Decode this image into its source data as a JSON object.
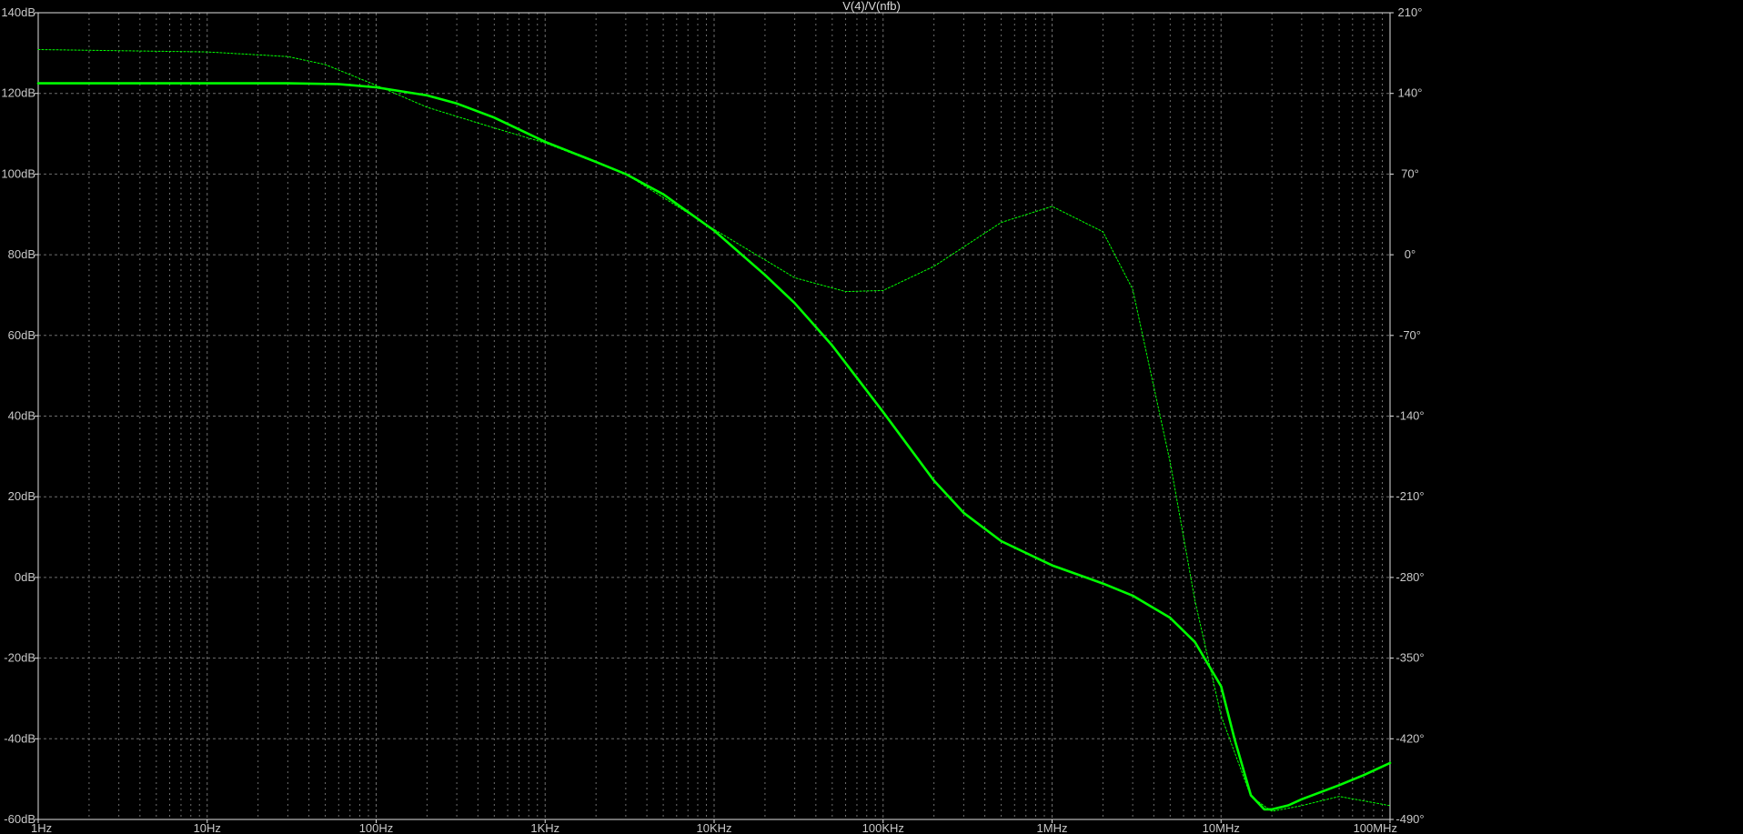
{
  "window": {
    "title": "V(4)/V(nfb)"
  },
  "colors": {
    "background": "#000000",
    "frame": "#e0e0e0",
    "grid": "#6e6e6e",
    "trace": "#00ff00",
    "text": "#c8c8c8"
  },
  "chart_data": {
    "type": "line",
    "title": "V(4)/V(nfb)",
    "xscale": "log",
    "xlim": [
      1,
      100000000
    ],
    "x_ticks": [
      {
        "value": 1,
        "label": "1Hz"
      },
      {
        "value": 10,
        "label": "10Hz"
      },
      {
        "value": 100,
        "label": "100Hz"
      },
      {
        "value": 1000,
        "label": "1KHz"
      },
      {
        "value": 10000,
        "label": "10KHz"
      },
      {
        "value": 100000,
        "label": "100KHz"
      },
      {
        "value": 1000000,
        "label": "1MHz"
      },
      {
        "value": 10000000,
        "label": "10MHz"
      },
      {
        "value": 100000000,
        "label": "100MHz"
      }
    ],
    "ylim_left": [
      -60,
      140
    ],
    "y_left_ticks": [
      {
        "value": 140,
        "label": "140dB"
      },
      {
        "value": 120,
        "label": "120dB"
      },
      {
        "value": 100,
        "label": "100dB"
      },
      {
        "value": 80,
        "label": "80dB"
      },
      {
        "value": 60,
        "label": "60dB"
      },
      {
        "value": 40,
        "label": "40dB"
      },
      {
        "value": 20,
        "label": "20dB"
      },
      {
        "value": 0,
        "label": "0dB"
      },
      {
        "value": -20,
        "label": "-20dB"
      },
      {
        "value": -40,
        "label": "-40dB"
      },
      {
        "value": -60,
        "label": "-60dB"
      }
    ],
    "ylim_right": [
      -490,
      210
    ],
    "y_right_ticks": [
      {
        "value": 210,
        "label": "210°"
      },
      {
        "value": 140,
        "label": "140°"
      },
      {
        "value": 70,
        "label": "70°"
      },
      {
        "value": 0,
        "label": "0°"
      },
      {
        "value": -70,
        "label": "-70°"
      },
      {
        "value": -140,
        "label": "-140°"
      },
      {
        "value": -210,
        "label": "-210°"
      },
      {
        "value": -280,
        "label": "-280°"
      },
      {
        "value": -350,
        "label": "-350°"
      },
      {
        "value": -420,
        "label": "-420°"
      },
      {
        "value": -490,
        "label": "-490°"
      }
    ],
    "grid": true,
    "series": [
      {
        "axis": "left",
        "style": "solid",
        "x": [
          1,
          10,
          30,
          60,
          100,
          200,
          300,
          500,
          1000,
          2000,
          3000,
          5000,
          10000,
          20000,
          30000,
          50000,
          100000,
          200000,
          300000,
          500000,
          1000000,
          2000000,
          3000000,
          5000000,
          7000000,
          10000000,
          12000000,
          15000000,
          18000000,
          20000000,
          25000000,
          30000000,
          50000000,
          70000000,
          100000000
        ],
        "y": [
          122.5,
          122.5,
          122.5,
          122.3,
          121.5,
          119.5,
          117.5,
          114.0,
          108.0,
          103.0,
          100.0,
          95.0,
          86.0,
          75.0,
          68.0,
          57.5,
          41.0,
          24.0,
          16.0,
          9.0,
          3.0,
          -1.5,
          -4.5,
          -10.0,
          -16.0,
          -27.0,
          -40.0,
          -54.0,
          -57.5,
          -57.5,
          -56.5,
          -55.0,
          -51.5,
          -49.0,
          -46.0
        ]
      },
      {
        "axis": "right",
        "style": "dotted",
        "x": [
          1,
          10,
          30,
          50,
          100,
          200,
          300,
          500,
          1000,
          3000,
          10000,
          30000,
          60000,
          100000,
          200000,
          500000,
          1000000,
          2000000,
          3000000,
          5000000,
          7000000,
          10000000,
          15000000,
          20000000,
          30000000,
          50000000,
          100000000
        ],
        "y": [
          178,
          176,
          172,
          165,
          147,
          128,
          120,
          110,
          97,
          70,
          22,
          -20,
          -32,
          -31,
          -10,
          28,
          42,
          20,
          -30,
          -180,
          -300,
          -400,
          -470,
          -483,
          -478,
          -470,
          -478
        ]
      }
    ]
  }
}
